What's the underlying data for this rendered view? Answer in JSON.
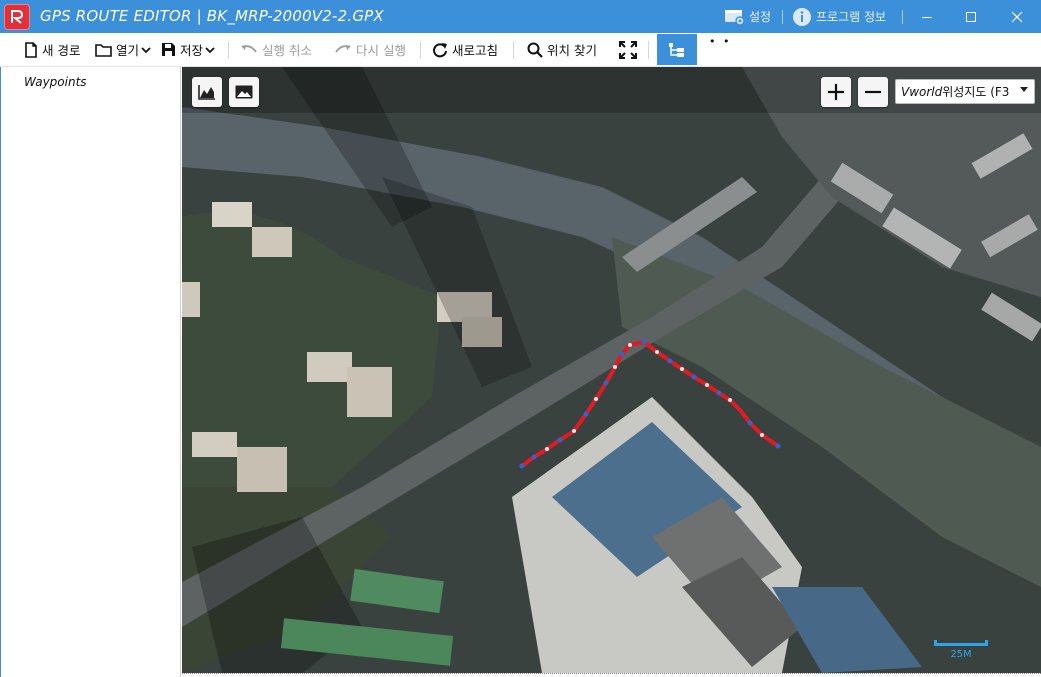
{
  "window": {
    "title": "GPS ROUTE EDITOR | BK_MRP-2000V2-2.GPX"
  },
  "titlebar": {
    "settings_label": "설정",
    "about_label": "프로그램 정보",
    "minimize_icon": "minimize-icon",
    "maximize_icon": "maximize-icon",
    "close_icon": "close-icon"
  },
  "toolbar": {
    "new_route": "새 경로",
    "open": "열기",
    "save": "저장",
    "undo": "실행 취소",
    "redo": "다시 실행",
    "refresh": "새로고침",
    "find_location": "위치 찾기",
    "more": "• •"
  },
  "sidebar": {
    "title": "Waypoints"
  },
  "map": {
    "layer_select": {
      "brand": "Vworld",
      "label": " 위성지도 (F3"
    },
    "scale_label": "25M",
    "route_color": "#e01b24",
    "waypoint_color": "#3a5fd0"
  }
}
